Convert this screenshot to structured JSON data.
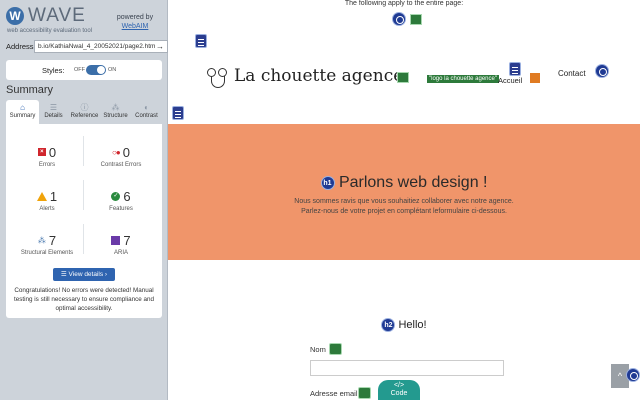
{
  "wave": {
    "logo_letter": "W",
    "logo_text": "WAVE",
    "tagline": "web accessibility evaluation tool",
    "powered_by": "powered by",
    "powered_link": "WebAIM",
    "address_label": "Address:",
    "address_value": "b.io/KathiaNwal_4_20052021/page2.htm",
    "address_go": "→",
    "styles_label": "Styles:",
    "styles_off": "OFF",
    "styles_on": "ON",
    "summary_heading": "Summary",
    "tabs": [
      {
        "label": "Summary",
        "icon": "home-icon",
        "glyph": "⌂"
      },
      {
        "label": "Details",
        "icon": "list-icon",
        "glyph": "☰"
      },
      {
        "label": "Reference",
        "icon": "info-icon",
        "glyph": "ⓘ"
      },
      {
        "label": "Structure",
        "icon": "structure-icon",
        "glyph": "⁂"
      },
      {
        "label": "Contrast",
        "icon": "contrast-icon",
        "glyph": "◐"
      }
    ],
    "stats": {
      "errors": {
        "count": "0",
        "label": "Errors"
      },
      "contrast_errors": {
        "count": "0",
        "label": "Contrast Errors"
      },
      "alerts": {
        "count": "1",
        "label": "Alerts"
      },
      "features": {
        "count": "6",
        "label": "Features"
      },
      "structural": {
        "count": "7",
        "label": "Structural Elements"
      },
      "aria": {
        "count": "7",
        "label": "ARIA"
      }
    },
    "view_details": "☰ View details ›",
    "congrats": "Congratulations! No errors were detected! Manual testing is still necessary to ensure compliance and optimal accessibility."
  },
  "site": {
    "apply_note": "The following apply to the entire page:",
    "brand": "La chouette agence",
    "logo_alt": "\"logo la chouette agence\"",
    "nav_accueil": "Accueil",
    "nav_contact": "Contact",
    "hero_title": "Parlons web design !",
    "hero_sub1": "Nous sommes ravis que vous souhaitiez collaborer avec notre agence.",
    "hero_sub2": "Parlez-nous de votre projet en complétant leformulaire ci-dessous.",
    "h1_badge": "h1",
    "h2_badge": "h2",
    "hello": "Hello!",
    "nom_label": "Nom",
    "email_label": "Adresse email",
    "code_glyph": "</>",
    "code_label": "Code",
    "scroll_glyph": "^"
  },
  "colors": {
    "wave_panel": "#cdd3da",
    "wave_blue": "#2f64b0",
    "hero_bg": "#f0956a",
    "error_red": "#d0262d",
    "alert_amber": "#f0a30a",
    "feature_green": "#2a8a3e",
    "aria_purple": "#6a3aa8",
    "code_teal": "#239a8f"
  }
}
